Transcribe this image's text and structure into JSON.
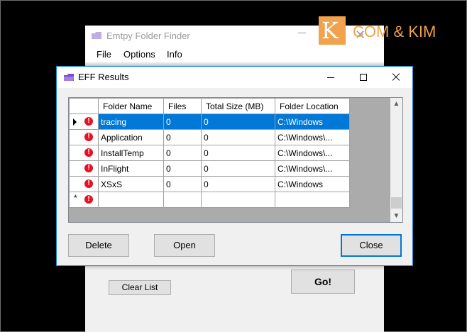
{
  "main_window": {
    "title": "Emtpy Folder Finder",
    "menu": [
      {
        "label": "File"
      },
      {
        "label": "Options"
      },
      {
        "label": "Info"
      }
    ],
    "clear_list_label": "Clear List",
    "go_label": "Go!"
  },
  "watermark": {
    "letter": "K",
    "text": "COM & KIM",
    "color": "#f0a24c"
  },
  "dialog": {
    "title": "EFF Results",
    "columns": [
      "Folder Name",
      "Files",
      "Total Size (MB)",
      "Folder Location"
    ],
    "rows": [
      {
        "name": "tracing",
        "files": "0",
        "size": "0",
        "location": "C:\\Windows",
        "selected": true
      },
      {
        "name": "Application",
        "files": "0",
        "size": "0",
        "location": "C:\\Windows\\..."
      },
      {
        "name": "InstallTemp",
        "files": "0",
        "size": "0",
        "location": "C:\\Windows\\..."
      },
      {
        "name": "InFlight",
        "files": "0",
        "size": "0",
        "location": "C:\\Windows\\..."
      },
      {
        "name": "XSxS",
        "files": "0",
        "size": "0",
        "location": "C:\\Windows"
      }
    ],
    "new_row_marker": "*",
    "buttons": {
      "delete": "Delete",
      "open": "Open",
      "close": "Close"
    }
  },
  "colors": {
    "selection": "#0078d7",
    "error_icon": "#e81123",
    "dialog_border": "#1883d7"
  }
}
